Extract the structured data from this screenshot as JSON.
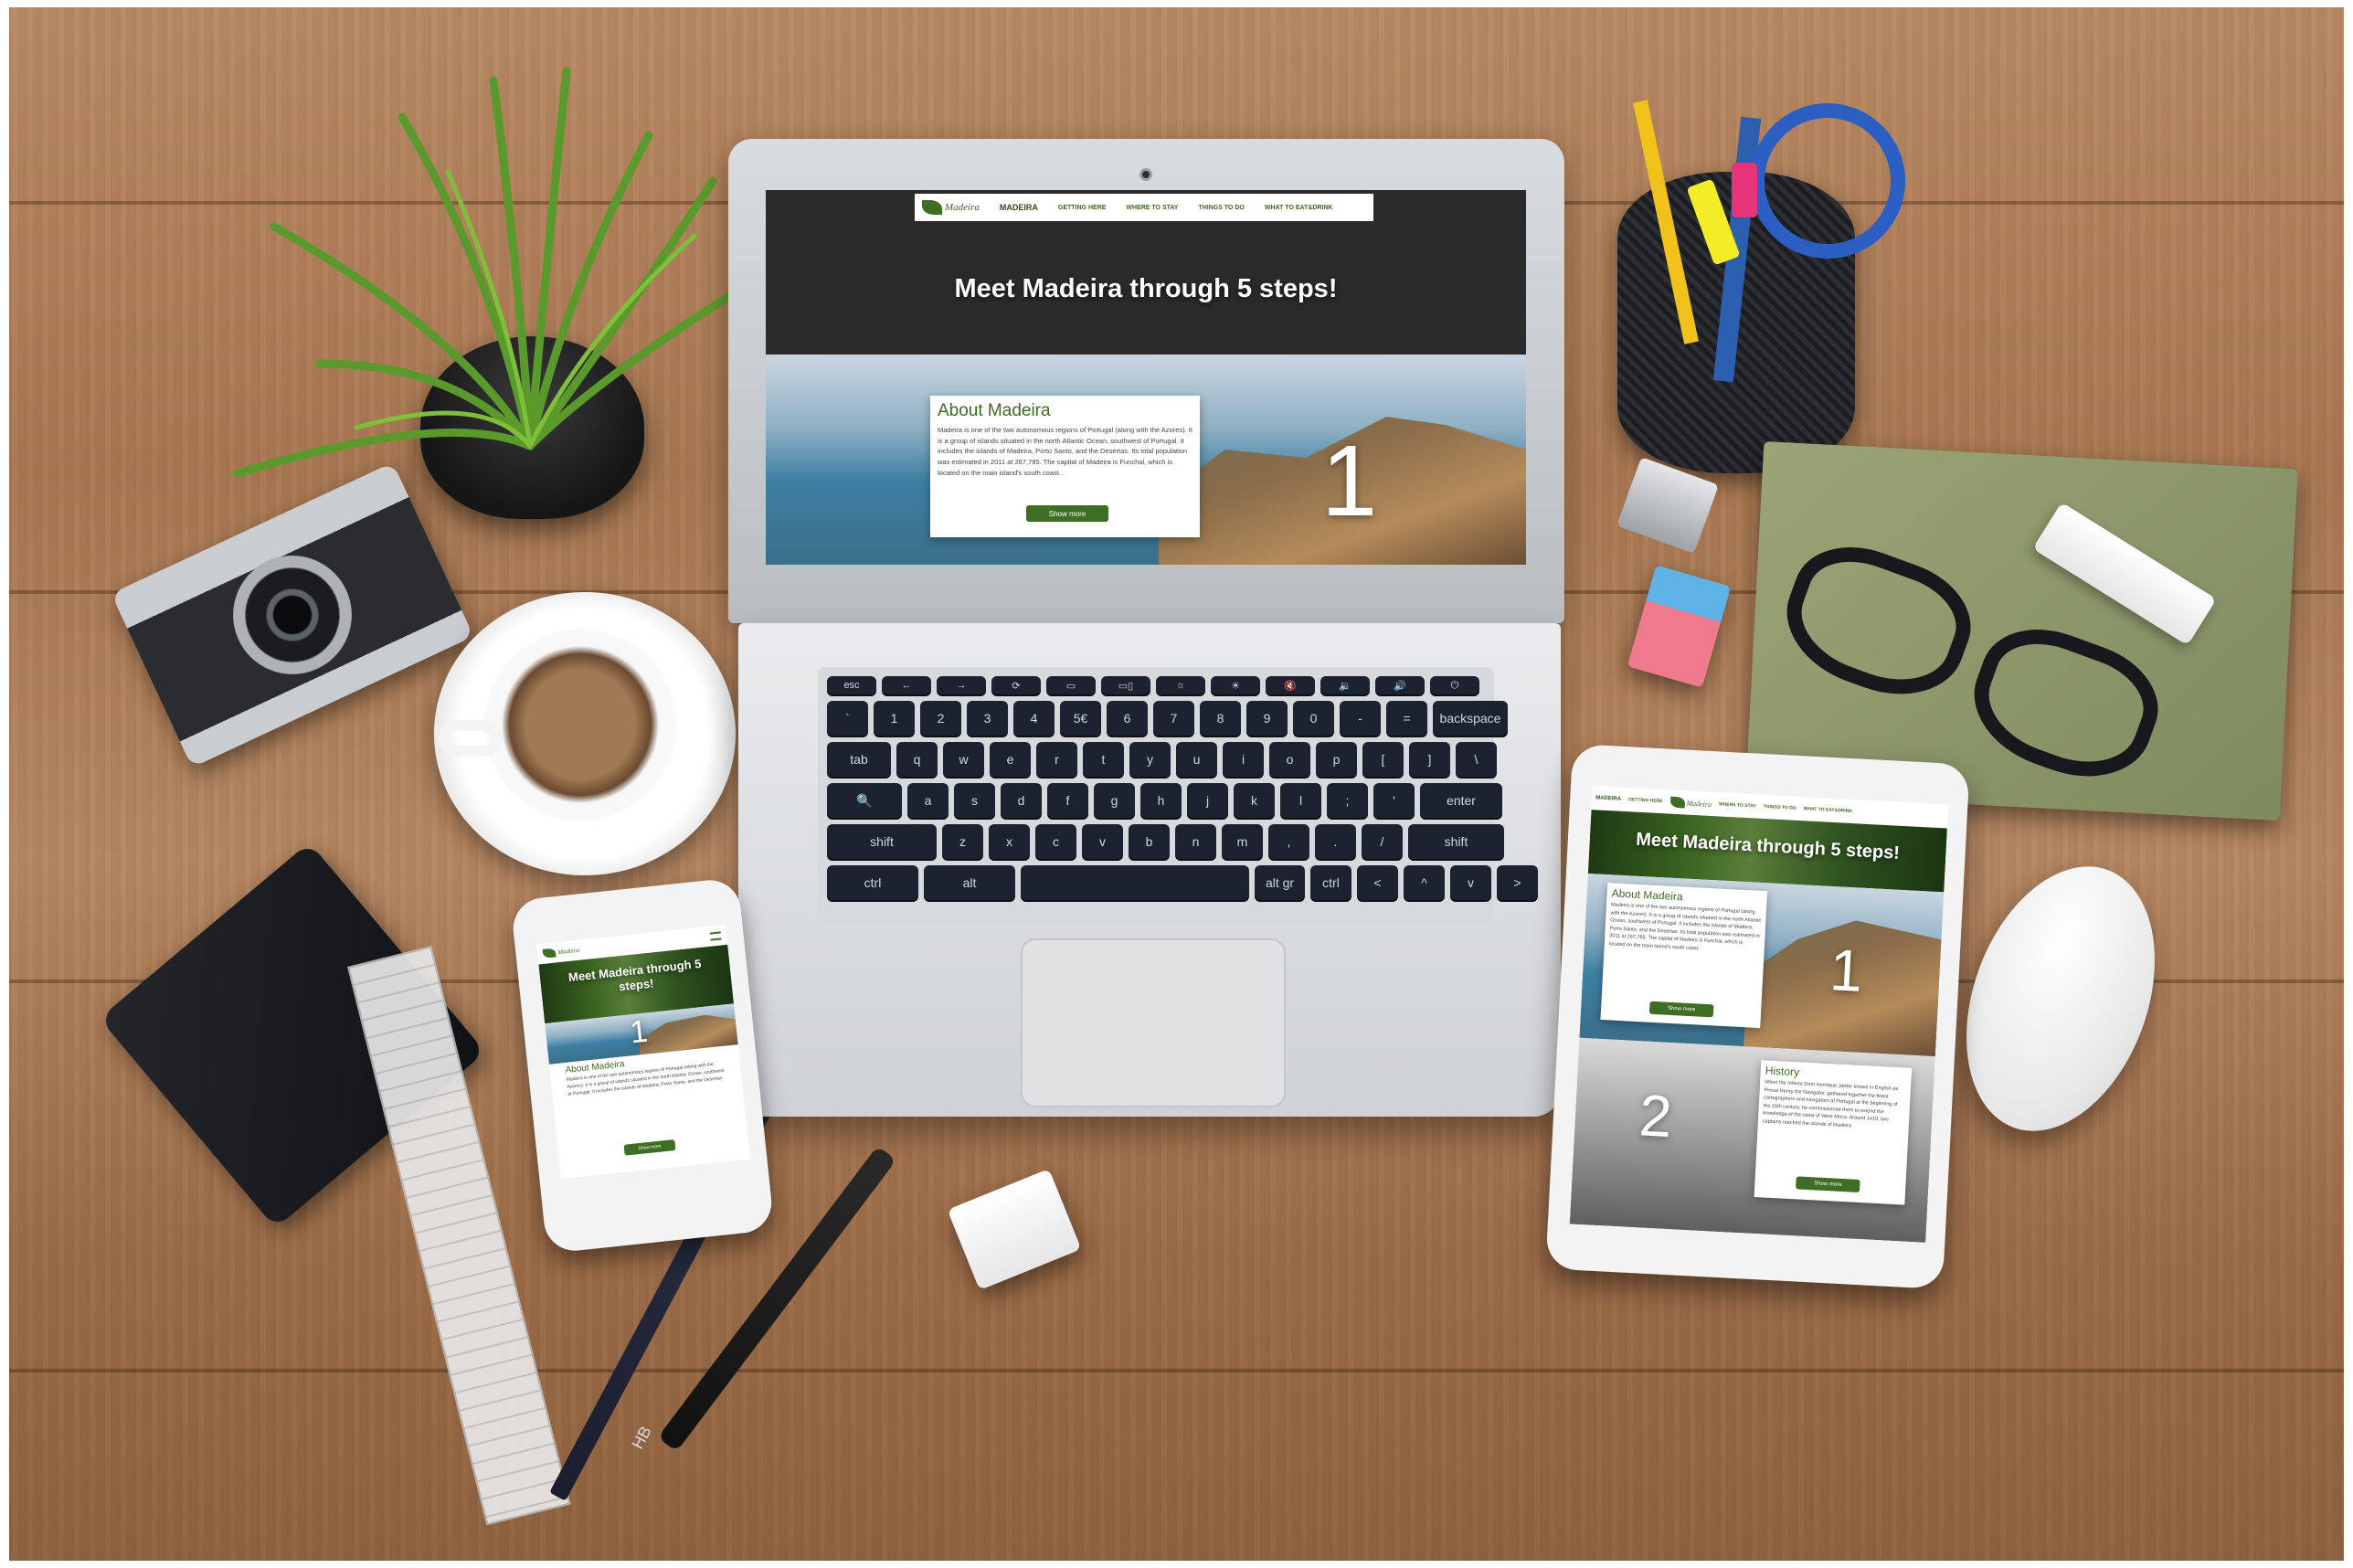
{
  "desktop_site": {
    "brand": "Madeira",
    "nav": [
      "MADEIRA",
      "GETTING HERE",
      "WHERE TO STAY",
      "THINGS TO DO",
      "WHAT TO EAT&DRINK"
    ],
    "hero_title": "Meet Madeira through 5 steps!",
    "section_number": "1",
    "about": {
      "title": "About Madeira",
      "text": "Madeira is one of the two autonomous regions of Portugal (along with the Azores). It is a group of islands situated in the north Atlantic Ocean, southwest of Portugal. It includes the islands of Madeira, Porto Santo, and the Desertas. Its total population was estimated in 2011 at 267,785. The capital of Madeira is Funchal, which is located on the main island's south coast...",
      "button": "Show more"
    }
  },
  "tablet_site": {
    "brand": "Madeira",
    "nav": [
      "MADEIRA",
      "GETTING HERE",
      "WHERE TO STAY",
      "THINGS TO DO",
      "WHAT TO EAT&DRINK"
    ],
    "hero_title": "Meet Madeira through 5 steps!",
    "section1_number": "1",
    "about_title": "About Madeira",
    "about_text": "Madeira is one of the two autonomous regions of Portugal (along with the Azores). It is a group of islands situated in the north Atlantic Ocean, southwest of Portugal. It includes the islands of Madeira, Porto Santo, and the Desertas. Its total population was estimated in 2011 at 267,785. The capital of Madeira is Funchal, which is located on the main island's south coast.",
    "about_button": "Show more",
    "section2_number": "2",
    "history_title": "History",
    "history_text": "When the Infante Dom Henrique, better known in English as Prince Henry the Navigator, gathered together the finest cartographers and navigators of Portugal at the beginning of the 15th century, he commissioned them to extend the knowledge of the coast of West Africa. Around 1419, two captains reached the islands of Madeira.",
    "history_button": "Show more"
  },
  "phone_site": {
    "brand": "Madeira",
    "hero_title": "Meet Madeira through 5 steps!",
    "section_number": "1",
    "about_title": "About Madeira",
    "about_text": "Madeira is one of the two autonomous regions of Portugal (along with the Azores). It is a group of islands situated in the north Atlantic Ocean, southwest of Portugal. It includes the islands of Madeira, Porto Santo, and the Desertas.",
    "about_button": "Show more"
  },
  "keyboard": {
    "row0": [
      "esc",
      "←",
      "→",
      "⟳",
      "▭",
      "▭▯",
      "☼",
      "☀",
      "🔇",
      "🔉",
      "🔊",
      "⏻"
    ],
    "row1": [
      "`",
      "1",
      "2",
      "3",
      "4",
      "5€",
      "6",
      "7",
      "8",
      "9",
      "0",
      "-",
      "=",
      "backspace"
    ],
    "row2": [
      "tab",
      "q",
      "w",
      "e",
      "r",
      "t",
      "y",
      "u",
      "i",
      "o",
      "p",
      "[",
      "]",
      "\\"
    ],
    "row3": [
      "🔍",
      "a",
      "s",
      "d",
      "f",
      "g",
      "h",
      "j",
      "k",
      "l",
      ";",
      "'",
      "enter"
    ],
    "row4": [
      "shift",
      "z",
      "x",
      "c",
      "v",
      "b",
      "n",
      "m",
      ",",
      ".",
      "/",
      "shift"
    ],
    "row5": [
      "ctrl",
      "alt",
      "",
      "alt gr",
      "ctrl",
      "<",
      "^",
      "v",
      ">"
    ]
  },
  "pencil_label": "HB",
  "colors": {
    "brand_green": "#3e6e24",
    "wood": "#a87852"
  }
}
